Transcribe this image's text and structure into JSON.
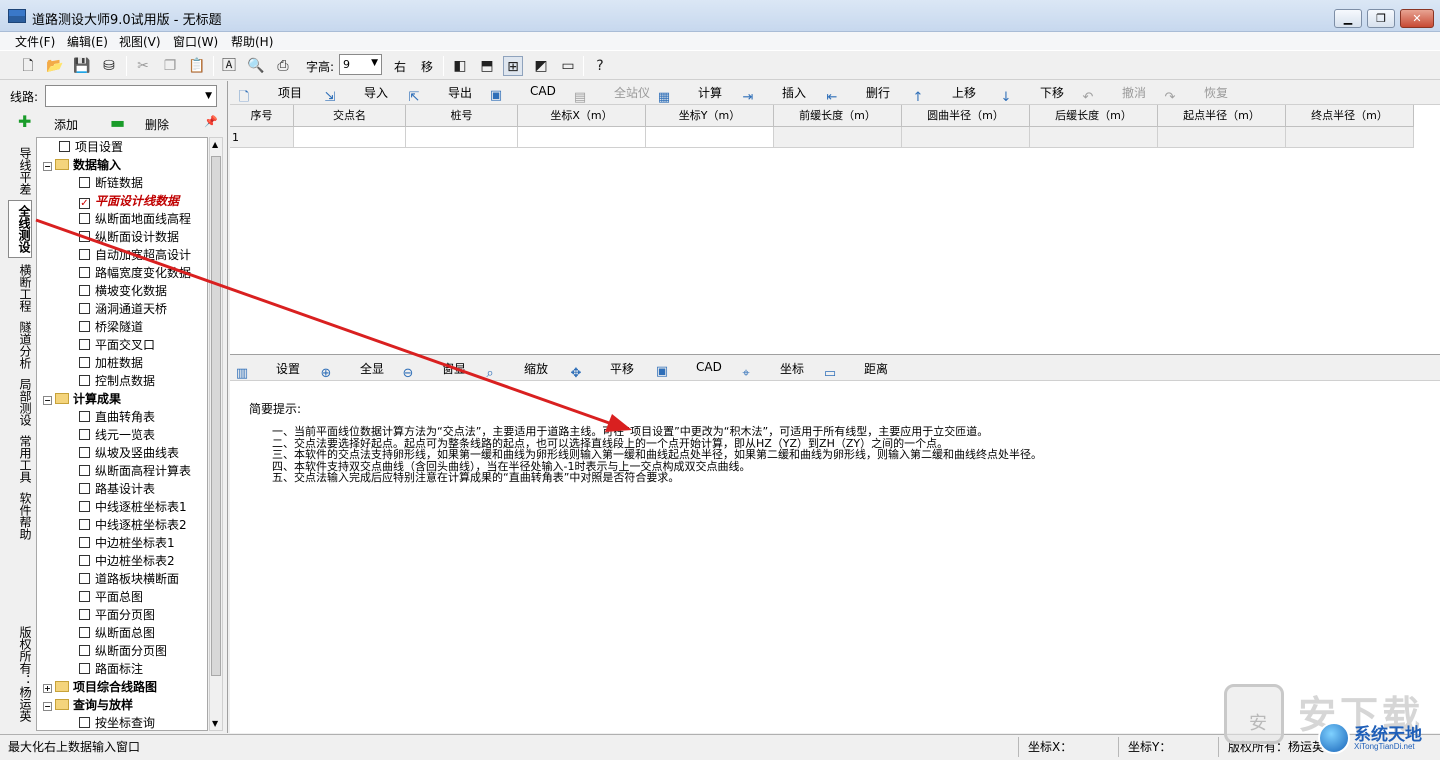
{
  "window": {
    "title": "道路测设大师9.0试用版 - 无标题",
    "controls": [
      "▁",
      "❐",
      "✕"
    ]
  },
  "menubar": {
    "items": [
      "文件(F)",
      "编辑(E)",
      "视图(V)",
      "窗口(W)",
      "帮助(H)"
    ]
  },
  "toolbar": {
    "font_height_label": "字高:",
    "font_height_value": "9",
    "right_label": "右",
    "move_label": "移"
  },
  "left": {
    "route_label": "线路:",
    "route_value": "",
    "add_label": "添加",
    "delete_label": "删除",
    "pin": "📌",
    "vtabs": [
      "导线平差",
      "全线测设",
      "横断工程",
      "隧道分析",
      "局部测设",
      "常用工具",
      "软件帮助",
      "版权所有：杨运英"
    ],
    "tree": [
      {
        "label": "项目设置",
        "type": "item",
        "checked": false
      },
      {
        "label": "数据输入",
        "type": "group"
      },
      {
        "label": "断链数据",
        "type": "item",
        "checked": false
      },
      {
        "label": "平面设计线数据",
        "type": "item",
        "checked": true,
        "highlight": true
      },
      {
        "label": "纵断面地面线高程",
        "type": "item",
        "checked": false
      },
      {
        "label": "纵断面设计数据",
        "type": "item",
        "checked": false
      },
      {
        "label": "自动加宽超高设计",
        "type": "item",
        "checked": false
      },
      {
        "label": "路幅宽度变化数据",
        "type": "item",
        "checked": false
      },
      {
        "label": "横坡变化数据",
        "type": "item",
        "checked": false
      },
      {
        "label": "涵洞通道天桥",
        "type": "item",
        "checked": false
      },
      {
        "label": "桥梁隧道",
        "type": "item",
        "checked": false
      },
      {
        "label": "平面交叉口",
        "type": "item",
        "checked": false
      },
      {
        "label": "加桩数据",
        "type": "item",
        "checked": false
      },
      {
        "label": "控制点数据",
        "type": "item",
        "checked": false
      },
      {
        "label": "计算成果",
        "type": "group"
      },
      {
        "label": "直曲转角表",
        "type": "item",
        "checked": false
      },
      {
        "label": "线元一览表",
        "type": "item",
        "checked": false
      },
      {
        "label": "纵坡及竖曲线表",
        "type": "item",
        "checked": false
      },
      {
        "label": "纵断面高程计算表",
        "type": "item",
        "checked": false
      },
      {
        "label": "路基设计表",
        "type": "item",
        "checked": false
      },
      {
        "label": "中线逐桩坐标表1",
        "type": "item",
        "checked": false
      },
      {
        "label": "中线逐桩坐标表2",
        "type": "item",
        "checked": false
      },
      {
        "label": "中边桩坐标表1",
        "type": "item",
        "checked": false
      },
      {
        "label": "中边桩坐标表2",
        "type": "item",
        "checked": false
      },
      {
        "label": "道路板块横断面",
        "type": "item",
        "checked": false
      },
      {
        "label": "平面总图",
        "type": "item",
        "checked": false
      },
      {
        "label": "平面分页图",
        "type": "item",
        "checked": false
      },
      {
        "label": "纵断面总图",
        "type": "item",
        "checked": false
      },
      {
        "label": "纵断面分页图",
        "type": "item",
        "checked": false
      },
      {
        "label": "路面标注",
        "type": "item",
        "checked": false
      },
      {
        "label": "项目综合线路图",
        "type": "group",
        "collapsed": true
      },
      {
        "label": "查询与放样",
        "type": "group"
      },
      {
        "label": "按坐标查询",
        "type": "item",
        "checked": false
      }
    ]
  },
  "grid_toolbar": [
    {
      "label": "项目",
      "icon": "new-doc-icon",
      "glyph": "🗋",
      "disabled": false
    },
    {
      "label": "导入",
      "icon": "import-icon",
      "glyph": "⇲",
      "disabled": false
    },
    {
      "label": "导出",
      "icon": "export-icon",
      "glyph": "⇱",
      "disabled": false
    },
    {
      "label": "CAD",
      "icon": "cad-icon",
      "glyph": "▣",
      "disabled": false
    },
    {
      "label": "全站仪",
      "icon": "total-station-icon",
      "glyph": "▤",
      "disabled": true
    },
    {
      "label": "计算",
      "icon": "calculator-icon",
      "glyph": "▦",
      "disabled": false
    },
    {
      "label": "插入",
      "icon": "insert-row-icon",
      "glyph": "⇥",
      "disabled": false
    },
    {
      "label": "删行",
      "icon": "delete-row-icon",
      "glyph": "⇤",
      "disabled": false
    },
    {
      "label": "上移",
      "icon": "move-up-icon",
      "glyph": "↑",
      "disabled": false
    },
    {
      "label": "下移",
      "icon": "move-down-icon",
      "glyph": "↓",
      "disabled": false
    },
    {
      "label": "撤消",
      "icon": "undo-icon",
      "glyph": "↶",
      "disabled": true
    },
    {
      "label": "恢复",
      "icon": "redo-icon",
      "glyph": "↷",
      "disabled": true
    }
  ],
  "grid": {
    "columns": [
      "序号",
      "交点名",
      "桩号",
      "坐标X（m）",
      "坐标Y（m）",
      "前缓长度（m）",
      "圆曲半径（m）",
      "后缓长度（m）",
      "起点半径（m）",
      "终点半径（m）"
    ],
    "rows": [
      [
        "1",
        "",
        "",
        "",
        "",
        "",
        "",
        "",
        "",
        ""
      ]
    ]
  },
  "view_toolbar": [
    {
      "label": "设置",
      "icon": "settings-icon",
      "glyph": "▥"
    },
    {
      "label": "全显",
      "icon": "zoom-extents-icon",
      "glyph": "⊕"
    },
    {
      "label": "窗显",
      "icon": "zoom-window-icon",
      "glyph": "⊖"
    },
    {
      "label": "缩放",
      "icon": "zoom-icon",
      "glyph": "⌕"
    },
    {
      "label": "平移",
      "icon": "pan-icon",
      "glyph": "✥"
    },
    {
      "label": "CAD",
      "icon": "cad-icon",
      "glyph": "▣"
    },
    {
      "label": "坐标",
      "icon": "coordinate-icon",
      "glyph": "⌖"
    },
    {
      "label": "距离",
      "icon": "distance-icon",
      "glyph": "▭"
    }
  ],
  "hints": {
    "title": "简要提示:",
    "lines": [
      "一、当前平面线位数据计算方法为“交点法”，主要适用于道路主线。可在“项目设置”中更改为“积木法”，可适用于所有线型，主要应用于立交匝道。",
      "二、交点法要选择好起点。起点可为整条线路的起点，也可以选择直线段上的一个点开始计算，即从HZ（YZ）到ZH（ZY）之间的一个点。",
      "三、本软件的交点法支持卵形线，如果第一缓和曲线为卵形线则输入第一缓和曲线起点处半径，如果第二缓和曲线为卵形线，则输入第二缓和曲线终点处半径。",
      "四、本软件支持双交点曲线（含回头曲线），当在半径处输入-1时表示与上一交点构成双交点曲线。",
      "五、交点法输入完成后应特别注意在计算成果的“直曲转角表”中对照是否符合要求。"
    ]
  },
  "status": {
    "message": "最大化右上数据输入窗口",
    "coord_x_label": "坐标X：",
    "coord_y_label": "坐标Y：",
    "copyright": "版权所有：杨运英"
  },
  "watermark": {
    "big_text": "安下载",
    "lock_text": "安",
    "brand_cn": "系统天地",
    "brand_en": "XiTongTianDi.net"
  },
  "colors": {
    "arrow": "#d92020",
    "highlight_text": "#c00000"
  }
}
